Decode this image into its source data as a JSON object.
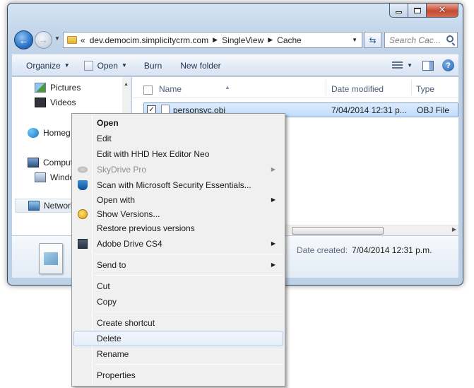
{
  "window": {
    "address": {
      "crumbs": [
        "dev.democim.simplicitycrm.com",
        "SingleView",
        "Cache"
      ],
      "overflow": "«"
    },
    "search_placeholder": "Search Cac..."
  },
  "toolbar": {
    "organize": "Organize",
    "open": "Open",
    "burn": "Burn",
    "new_folder": "New folder"
  },
  "nav_pane": {
    "items": [
      {
        "label": "Pictures",
        "icon": "pictures-icon"
      },
      {
        "label": "Videos",
        "icon": "videos-icon"
      },
      {
        "label": "Homeg",
        "icon": "homegroup-icon"
      },
      {
        "label": "Comput",
        "icon": "computer-icon"
      },
      {
        "label": "Windo",
        "icon": "drive-icon"
      },
      {
        "label": "Network",
        "icon": "network-icon"
      }
    ]
  },
  "file_list": {
    "columns": {
      "name": "Name",
      "date_modified": "Date modified",
      "type": "Type"
    },
    "rows": [
      {
        "name": "personsvc.obj",
        "date_modified": "7/04/2014 12:31 p...",
        "type": "OBJ File",
        "checked": true
      }
    ]
  },
  "details": {
    "date_created_label": "Date created:",
    "date_created_value": "7/04/2014 12:31 p.m."
  },
  "context_menu": {
    "items": [
      {
        "label": "Open",
        "bold": true
      },
      {
        "label": "Edit"
      },
      {
        "label": "Edit with HHD Hex Editor Neo"
      },
      {
        "label": "SkyDrive Pro",
        "disabled": true,
        "submenu": true,
        "icon": "skydrive-icon"
      },
      {
        "label": "Scan with Microsoft Security Essentials...",
        "icon": "security-essentials-icon"
      },
      {
        "label": "Open with",
        "submenu": true
      },
      {
        "label": "Show Versions...",
        "icon": "versions-icon"
      },
      {
        "label": "Restore previous versions"
      },
      {
        "label": "Adobe Drive CS4",
        "submenu": true,
        "icon": "adobe-drive-icon"
      },
      {
        "label": "Send to",
        "submenu": true
      },
      {
        "label": "Cut"
      },
      {
        "label": "Copy"
      },
      {
        "label": "Create shortcut"
      },
      {
        "label": "Delete",
        "hovered": true
      },
      {
        "label": "Rename"
      },
      {
        "label": "Properties"
      }
    ],
    "submenu_arrow": "▶"
  }
}
